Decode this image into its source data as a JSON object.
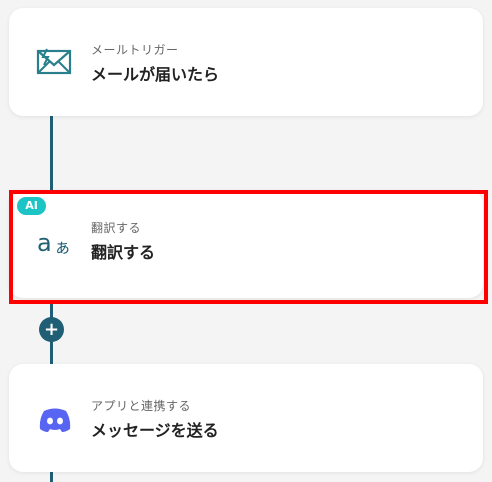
{
  "steps": [
    {
      "sub": "メールトリガー",
      "title": "メールが届いたら",
      "icon": "mail-trigger-icon"
    },
    {
      "sub": "翻訳する",
      "title": "翻訳する",
      "icon": "translate-icon",
      "badge": "AI"
    },
    {
      "sub": "アプリと連携する",
      "title": "メッセージを送る",
      "icon": "discord-icon"
    }
  ],
  "add_button_label": "+",
  "colors": {
    "connector": "#1f5e74",
    "highlight": "#ff0000",
    "ai_badge": "#1cc4c6",
    "discord": "#5865f2",
    "mail_icon": "#2a7f8c"
  }
}
